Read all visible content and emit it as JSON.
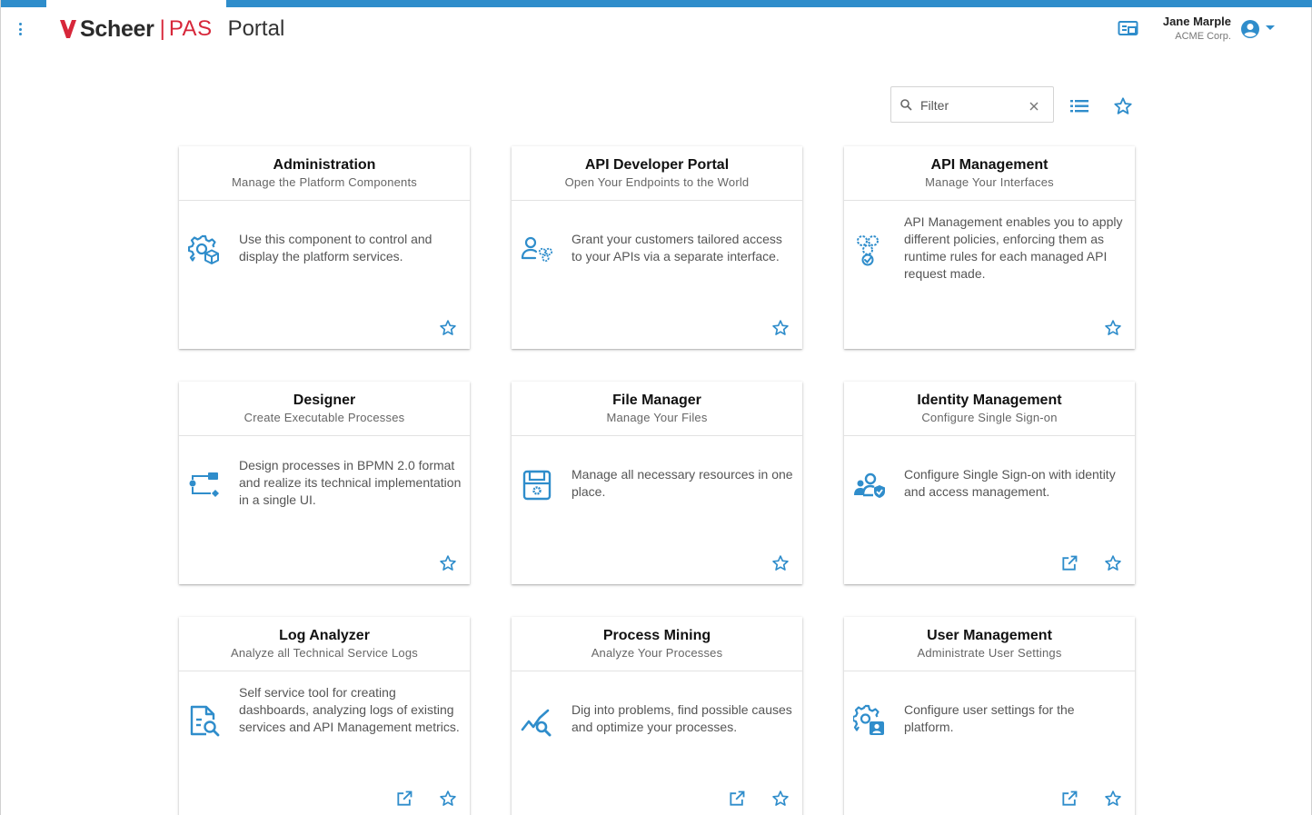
{
  "header": {
    "brand_scheer": "Scheer",
    "brand_sep": "|",
    "brand_pas": "PAS",
    "brand_portal": "Portal",
    "user_name": "Jane Marple",
    "user_org": "ACME Corp."
  },
  "toolbar": {
    "filter_placeholder": "Filter"
  },
  "colors": {
    "accent": "#2f8dcb",
    "brand_red": "#d7273a"
  },
  "cards": [
    {
      "title": "Administration",
      "subtitle": "Manage the Platform Components",
      "description": "Use this component to control and display the platform services.",
      "icon": "gear-cube-icon",
      "external": false
    },
    {
      "title": "API Developer Portal",
      "subtitle": "Open Your Endpoints to the World",
      "description": "Grant your customers tailored access to your APIs via a separate interface.",
      "icon": "user-gears-icon",
      "external": false
    },
    {
      "title": "API Management",
      "subtitle": "Manage Your Interfaces",
      "description": "API Management enables you to apply different policies, enforcing them as runtime rules for each managed API request made.",
      "icon": "gears-check-icon",
      "external": false
    },
    {
      "title": "Designer",
      "subtitle": "Create Executable Processes",
      "description": "Design processes in BPMN 2.0 format and realize its technical implementation in a single UI.",
      "icon": "process-flow-icon",
      "external": false
    },
    {
      "title": "File Manager",
      "subtitle": "Manage Your Files",
      "description": "Manage all necessary resources in one place.",
      "icon": "file-gear-icon",
      "external": false
    },
    {
      "title": "Identity Management",
      "subtitle": "Configure Single Sign-on",
      "description": "Configure Single Sign-on with identity and access management.",
      "icon": "users-shield-icon",
      "external": true
    },
    {
      "title": "Log Analyzer",
      "subtitle": "Analyze all Technical Service Logs",
      "description": "Self service tool for creating dashboards, analyzing logs of existing services and API Management metrics.",
      "icon": "document-search-icon",
      "external": true
    },
    {
      "title": "Process Mining",
      "subtitle": "Analyze Your Processes",
      "description": "Dig into problems, find possible causes and optimize your processes.",
      "icon": "chart-search-icon",
      "external": true
    },
    {
      "title": "User Management",
      "subtitle": "Administrate User Settings",
      "description": "Configure user settings for the platform.",
      "icon": "gear-user-icon",
      "external": true
    }
  ]
}
